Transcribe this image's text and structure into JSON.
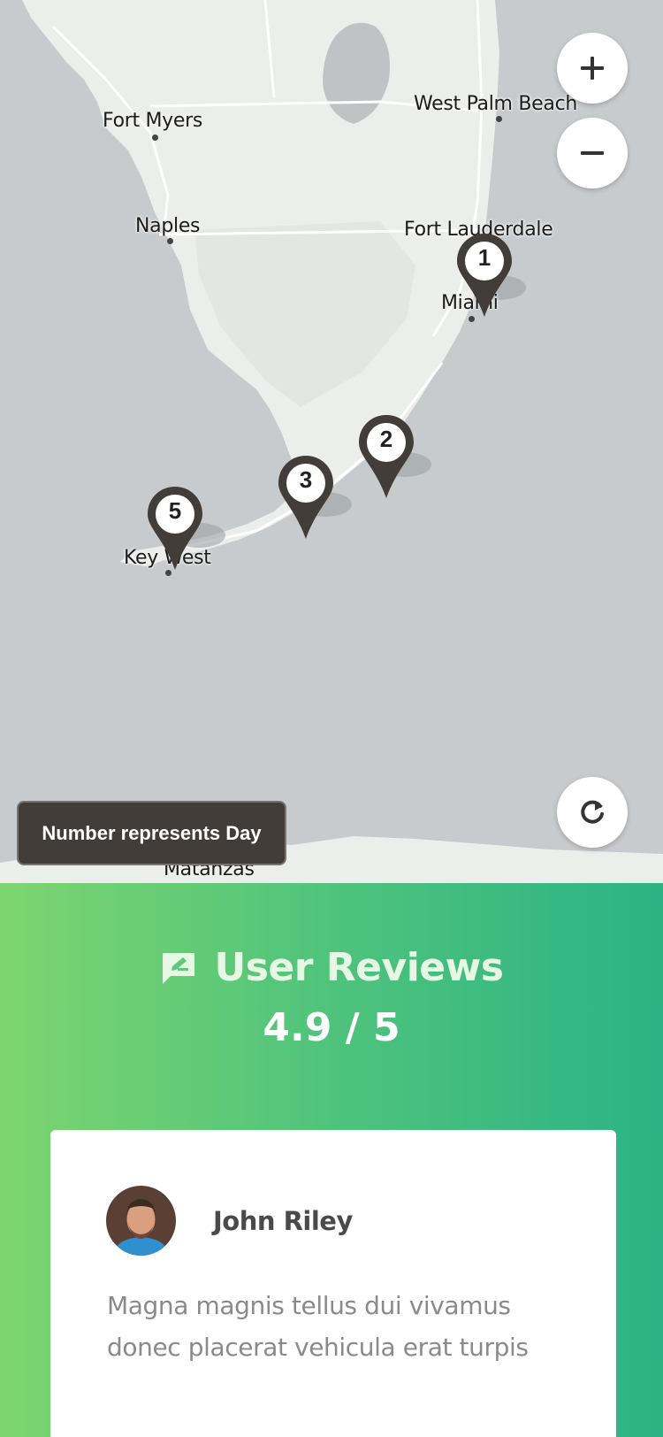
{
  "map": {
    "cities": [
      {
        "id": "fort-myers",
        "label": "Fort Myers"
      },
      {
        "id": "west-palm-beach",
        "label": "West Palm Beach"
      },
      {
        "id": "naples",
        "label": "Naples"
      },
      {
        "id": "fort-lauderdale",
        "label": "Fort Lauderdale"
      },
      {
        "id": "miami",
        "label": "Miami"
      },
      {
        "id": "key-west",
        "label": "Key West"
      },
      {
        "id": "matanzas",
        "label": "Matanzas"
      }
    ],
    "markers": [
      {
        "day": "1"
      },
      {
        "day": "2"
      },
      {
        "day": "3"
      },
      {
        "day": "5"
      }
    ],
    "zoom_in_icon": "plus-icon",
    "zoom_out_icon": "minus-icon",
    "reset_icon": "refresh-icon",
    "legend_text": "Number represents Day",
    "colors": {
      "water": "#c7cbce",
      "land": "#eceeec",
      "marker": "#433d39"
    }
  },
  "reviews": {
    "icon": "review-comment-icon",
    "title": "User Reviews",
    "score": "4.9 / 5",
    "items": [
      {
        "name": "John Riley",
        "avatar_icon": "avatar",
        "text": "Magna magnis tellus dui vivamus donec placerat vehicula erat turpis"
      }
    ],
    "colors": {
      "gradient_start": "#7dd56f",
      "gradient_end": "#2bb385"
    }
  }
}
